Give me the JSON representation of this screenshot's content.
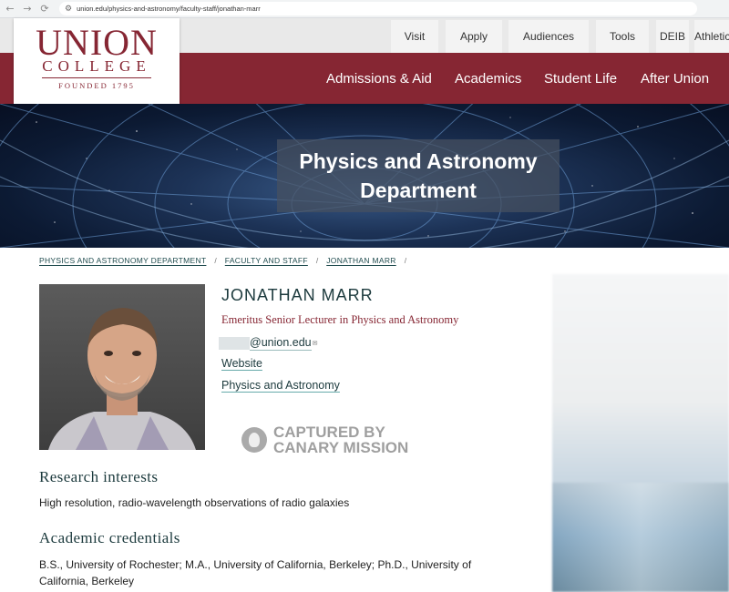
{
  "browser": {
    "url": "union.edu/physics-and-astronomy/faculty-staff/jonathan-marr",
    "back_icon": "←",
    "forward_icon": "→",
    "reload_icon": "⟳"
  },
  "utility_nav": {
    "items": [
      "Visit",
      "Apply",
      "Audiences",
      "Tools",
      "DEIB",
      "Athletics"
    ]
  },
  "main_nav": {
    "items": [
      "Admissions & Aid",
      "Academics",
      "Student Life",
      "After Union"
    ]
  },
  "logo": {
    "union": "UNION",
    "college": "COLLEGE",
    "founded": "FOUNDED 1795"
  },
  "hero": {
    "title": "Physics and Astronomy Department"
  },
  "breadcrumb": {
    "items": [
      "PHYSICS AND ASTRONOMY DEPARTMENT",
      "FACULTY AND STAFF",
      "JONATHAN MARR"
    ],
    "separator": "/"
  },
  "profile": {
    "name": "JONATHAN MARR",
    "title": "Emeritus Senior Lecturer in Physics and Astronomy",
    "email_domain": "@union.edu",
    "email_icon": "✉",
    "website_label": "Website",
    "department_label": "Physics and Astronomy"
  },
  "watermark": {
    "line1": "CAPTURED BY",
    "line2": "CANARY MISSION"
  },
  "sections": {
    "research_heading": "Research interests",
    "research_text": "High resolution, radio-wavelength observations of radio galaxies",
    "credentials_heading": "Academic credentials",
    "credentials_text": "B.S., University of Rochester; M.A., University of California, Berkeley; Ph.D., University of California, Berkeley"
  },
  "colors": {
    "brand_garnet": "#862633",
    "teal_text": "#1c3a3d"
  }
}
